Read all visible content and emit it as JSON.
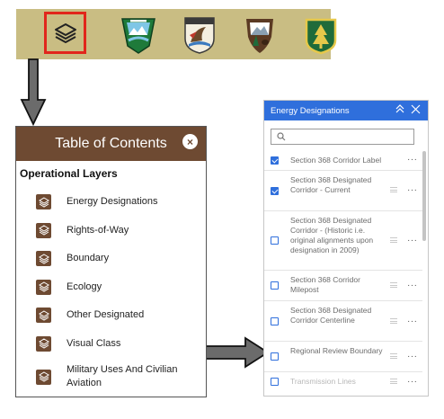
{
  "toolbar": {
    "layers_button": {
      "icon": "layers-icon"
    },
    "agency_logos": [
      "blm-logo",
      "usfws-logo",
      "nps-logo",
      "usfs-logo"
    ]
  },
  "toc": {
    "title": "Table of Contents",
    "close_label": "×",
    "section": "Operational Layers",
    "items": [
      {
        "label": "Energy Designations",
        "icon": "layers-icon"
      },
      {
        "label": "Rights-of-Way",
        "icon": "layers-icon"
      },
      {
        "label": "Boundary",
        "icon": "layers-icon"
      },
      {
        "label": "Ecology",
        "icon": "layers-icon"
      },
      {
        "label": "Other Designated",
        "icon": "layers-icon"
      },
      {
        "label": "Visual Class",
        "icon": "layers-icon"
      },
      {
        "label": "Military Uses And  Civilian Aviation",
        "icon": "layers-icon"
      }
    ]
  },
  "energy_panel": {
    "title": "Energy Designations",
    "collapse_icon": "chevron-double-up-icon",
    "close_icon": "close-icon",
    "search_placeholder": "",
    "more_label": "···",
    "layers": [
      {
        "label": "Section 368 Corridor Label",
        "checked": true,
        "draggable": false,
        "dim": false
      },
      {
        "label": "Section 368 Designated Corridor - Current",
        "checked": true,
        "draggable": true,
        "dim": false
      },
      {
        "label": "Section 368 Designated Corridor - (Historic i.e. original alignments upon designation in 2009)",
        "checked": false,
        "draggable": true,
        "dim": false
      },
      {
        "label": "Section 368 Corridor Milepost",
        "checked": false,
        "draggable": true,
        "dim": false
      },
      {
        "label": "Section 368 Designated Corridor Centerline",
        "checked": false,
        "draggable": true,
        "dim": false
      },
      {
        "label": "Regional Review Boundary",
        "checked": false,
        "draggable": true,
        "dim": false
      },
      {
        "label": "Transmission Lines",
        "checked": false,
        "draggable": true,
        "dim": true
      }
    ]
  },
  "colors": {
    "toolbar_bg": "#c9bd83",
    "highlight_red": "#e1261c",
    "toc_header": "#6e4a32",
    "panel_blue": "#2f6fdc",
    "arrow_gray": "#6b6b6b"
  }
}
